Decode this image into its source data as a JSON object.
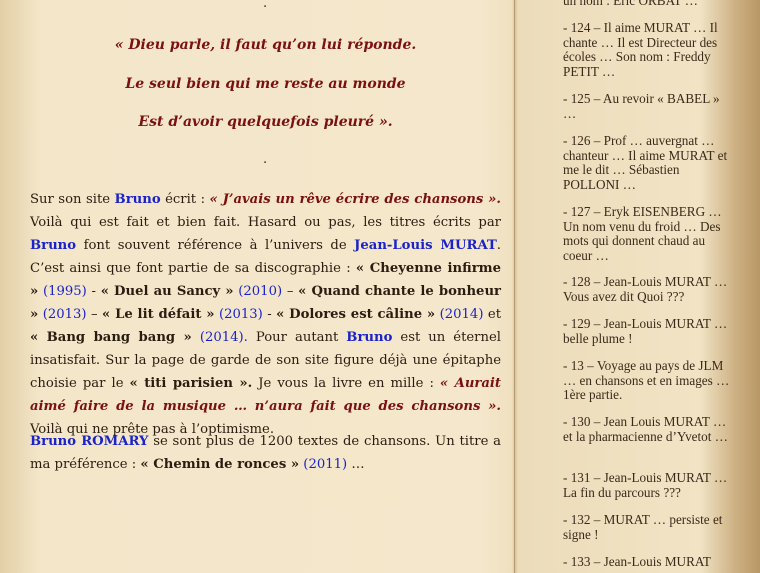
{
  "main": {
    "dot_top": ".",
    "poem": [
      "« Dieu parle, il faut qu’on lui réponde.",
      "Le seul bien qui me reste au monde",
      "Est d’avoir quelquefois pleuré »."
    ],
    "dot_mid": ".",
    "para1": {
      "t1": "Sur son site ",
      "bruno": "Bruno",
      "t2": " écrit : ",
      "quote1": "« J’avais un rêve écrire des chansons ».",
      "t3": " Voilà qui est fait et bien fait. Hasard ou pas, les titres écrits par ",
      "bruno2": "Bruno",
      "t4": " font souvent référence à l’univers de ",
      "jlm": "Jean-Louis MURAT",
      "t5": ".  C’est ainsi que font partie de sa discographie : ",
      "s1": "« Cheyenne infirme »",
      "y1": "(1995)",
      "sep1": " - ",
      "s2": "« Duel au Sancy »",
      "y2": "(2010)",
      "sep2": " – ",
      "s3": "« Quand chante le bonheur »",
      "y3": "(2013)",
      "sep3": " – ",
      "s4": "« Le lit défait »",
      "y4": "(2013)",
      "sep4": " - ",
      "s5": "« Dolores est câline »",
      "y5": "(2014)",
      "et": " et ",
      "s6": "« Bang bang bang »",
      "y6": "(2014).",
      "t6": " Pour autant ",
      "bruno3": "Bruno",
      "t7": " est un éternel insatisfait. Sur la page de garde de son site figure déjà une épitaphe choisie par le ",
      "titi": "« titi parisien ».",
      "t8": " Je vous la livre en mille : ",
      "quote2": "« Aurait aimé faire de la musique … n’aura fait que des chansons ».",
      "t9": " Voilà qui ne prête pas à l’optimisme."
    },
    "para2": {
      "name": "Bruno ROMARY",
      "t1": " se sont plus de 1200 textes de chansons. Un titre a ma préférence : ",
      "song": "« Chemin de ronces »",
      "year": "(2011)",
      "t2": " …"
    }
  },
  "sidebar": {
    "items": [
      "un nom : Eric ORBAT …",
      "- 124 – Il aime MURAT … Il chante … Il est Directeur des écoles … Son nom : Freddy PETIT …",
      "- 125 – Au revoir « BABEL » …",
      "- 126 – Prof … auvergnat … chanteur … Il aime MURAT et me le dit … Sébastien POLLONI …",
      "- 127 – Eryk EISENBERG … Un nom venu du froid … Des mots qui donnent chaud au coeur …",
      "- 128 – Jean-Louis MURAT … Vous avez dit Quoi ???",
      "- 129 – Jean-Louis MURAT … belle plume !",
      "- 13 – Voyage au pays de JLM … en chansons et en images … 1ère partie.",
      "- 130 – Jean Louis MURAT … et la pharmacienne d’Yvetot …",
      "- 131 – Jean-Louis MURAT … La fin du parcours ???",
      "- 132 – MURAT … persiste et signe !",
      "- 133 – Jean-Louis MURAT"
    ]
  }
}
